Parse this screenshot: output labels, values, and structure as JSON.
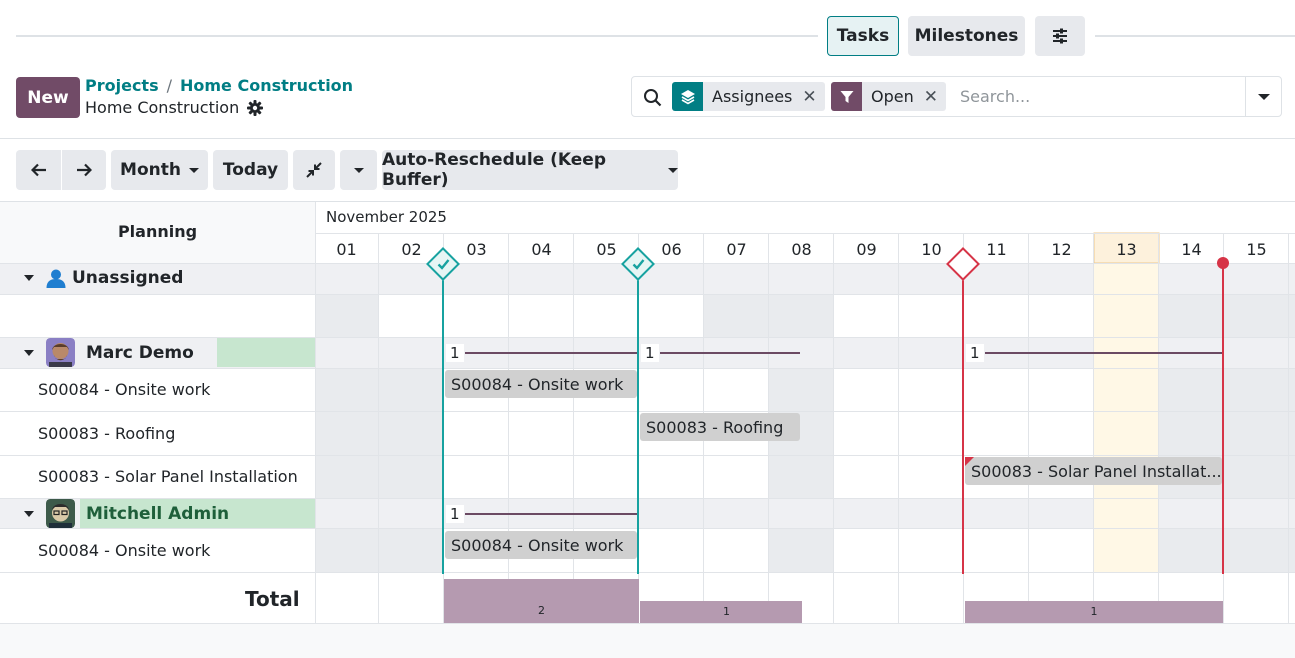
{
  "views": {
    "tasks": "Tasks",
    "milestones": "Milestones"
  },
  "header": {
    "new_label": "New",
    "breadcrumb": [
      "Projects",
      "Home Construction"
    ],
    "subtitle": "Home Construction"
  },
  "search": {
    "facets": [
      {
        "label": "Assignees",
        "icon": "layers-icon",
        "color": "#017e84"
      },
      {
        "label": "Open",
        "icon": "filter-icon",
        "color": "#714b67"
      }
    ],
    "placeholder": "Search..."
  },
  "toolbar": {
    "scale": "Month",
    "today": "Today",
    "reschedule": "Auto-Reschedule (Keep Buffer)"
  },
  "gantt": {
    "planning_label": "Planning",
    "month_label": "November 2025",
    "days": [
      "01",
      "02",
      "03",
      "04",
      "05",
      "06",
      "07",
      "08",
      "09",
      "10",
      "11",
      "12",
      "13",
      "14",
      "15"
    ],
    "today": "13",
    "groups": [
      {
        "label": "Unassigned",
        "rows": []
      },
      {
        "label": "Marc Demo",
        "counts": [
          "1",
          "1",
          "1"
        ],
        "rows": [
          {
            "label": "S00084 - Onsite work",
            "pill": "S00084 - Onsite work"
          },
          {
            "label": "S00083 - Roofing",
            "pill": "S00083 - Roofing"
          },
          {
            "label": "S00083 - Solar Panel Installation",
            "pill": "S00083 - Solar Panel Installat..."
          }
        ]
      },
      {
        "label": "Mitchell Admin",
        "counts": [
          "1"
        ],
        "rows": [
          {
            "label": "S00084 - Onsite work",
            "pill": "S00084 - Onsite work"
          }
        ]
      }
    ],
    "total_label": "Total",
    "totals": [
      {
        "value": "2"
      },
      {
        "value": "1"
      },
      {
        "value": "1"
      }
    ],
    "colors": {
      "accent": "#017e84",
      "brand": "#714b67",
      "deadline": "#d63447",
      "today_bg": "#fff8e6"
    }
  }
}
